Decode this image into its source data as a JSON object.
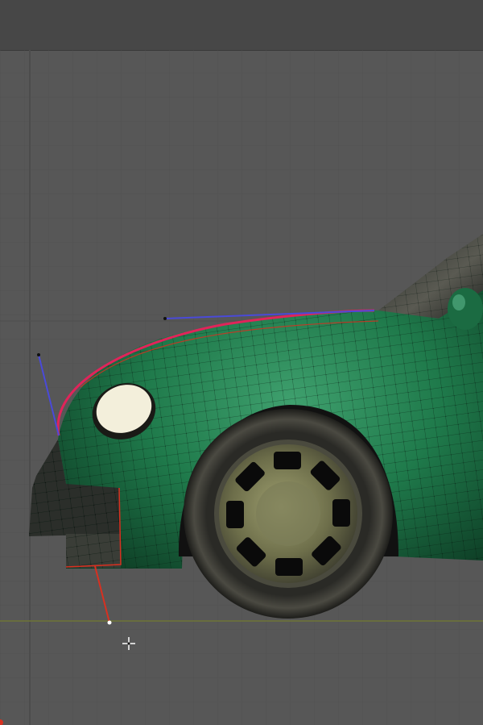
{
  "viewport": {
    "background_color": "#575757",
    "header_color": "#474747",
    "grid_color": "#4e4e4e",
    "ground_line_color": "#6f7536"
  },
  "model": {
    "body_color": "#1f7a4b",
    "body_highlight_color": "#4fb07e",
    "body_shadow_color": "#0e3d25",
    "wire_color": "#000000",
    "selected_edge_color": "#e0245a",
    "handle_color_blue": "#4a4ad8",
    "handle_color_red": "#d83020"
  },
  "icons": {
    "cursor": "crosshair-cursor-icon",
    "origin": "origin-marker-icon"
  }
}
